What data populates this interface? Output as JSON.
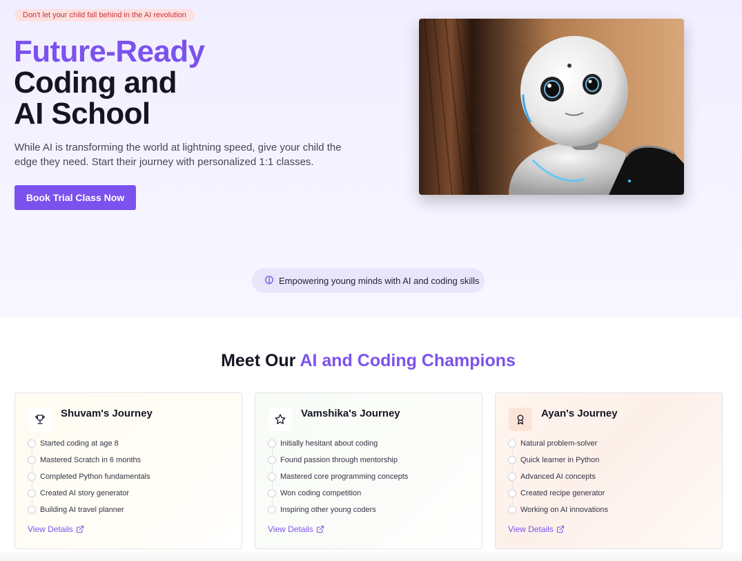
{
  "hero": {
    "badge": "Don't let your child fall behind in the AI revolution",
    "title_accent": "Future-Ready",
    "title_line2": "Coding and",
    "title_line3": "AI School",
    "description": "While AI is transforming the world at lightning speed, give your child the edge they need. Start their journey with personalized 1:1 classes.",
    "cta_label": "Book Trial Class Now",
    "image_subject": "robot-photo"
  },
  "tagline": {
    "text": "Empowering young minds with AI and coding skills",
    "icon": "brain-icon"
  },
  "champions": {
    "title_prefix": "Meet Our ",
    "title_accent": "AI and Coding Champions",
    "link_label": "View Details",
    "cards": [
      {
        "icon": "trophy-icon",
        "title": "Shuvam's Journey",
        "milestones": [
          "Started coding at age 8",
          "Mastered Scratch in 6 months",
          "Completed Python fundamentals",
          "Created AI story generator",
          "Building AI travel planner"
        ]
      },
      {
        "icon": "star-icon",
        "title": "Vamshika's Journey",
        "milestones": [
          "Initially hesitant about coding",
          "Found passion through mentorship",
          "Mastered core programming concepts",
          "Won coding competition",
          "Inspiring other young coders"
        ]
      },
      {
        "icon": "award-icon",
        "title": "Ayan's Journey",
        "milestones": [
          "Natural problem-solver",
          "Quick learner in Python",
          "Advanced AI concepts",
          "Created recipe generator",
          "Working on AI innovations"
        ]
      }
    ]
  },
  "colors": {
    "accent": "#7b52ee",
    "badge_bg": "#fde1e1",
    "badge_text": "#c8323a",
    "hero_bg": "#f3f1ff"
  }
}
